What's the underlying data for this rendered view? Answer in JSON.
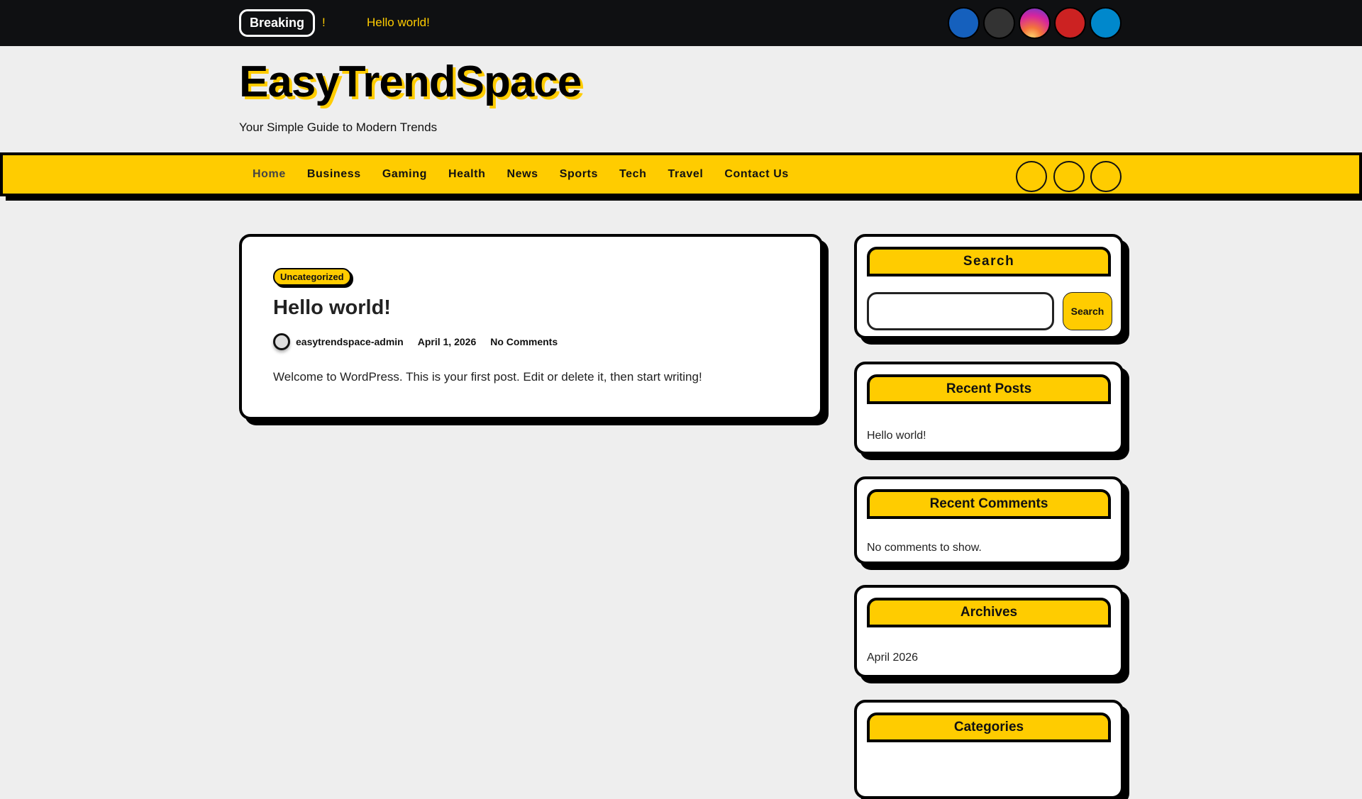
{
  "topbar": {
    "breaking_label": "Breaking",
    "ticker_separator": "!",
    "ticker_item": "Hello world!",
    "social": [
      {
        "icon": "facebook-icon",
        "color": "#1560bd"
      },
      {
        "icon": "x-twitter-icon",
        "color": "#333333"
      },
      {
        "icon": "instagram-icon",
        "color": "#d6249f"
      },
      {
        "icon": "youtube-icon",
        "color": "#cc2222"
      },
      {
        "icon": "telegram-icon",
        "color": "#0088cc"
      }
    ]
  },
  "header": {
    "site_title": "EasyTrendSpace",
    "tagline": "Your Simple Guide to Modern Trends"
  },
  "nav": {
    "items": [
      "Home",
      "Business",
      "Gaming",
      "Health",
      "News",
      "Sports",
      "Tech",
      "Travel",
      "Contact Us"
    ]
  },
  "post": {
    "category": "Uncategorized",
    "title": "Hello world!",
    "author": "easytrendspace-admin",
    "date": "April 1, 2026",
    "comments": "No Comments",
    "excerpt": "Welcome to WordPress. This is your first post. Edit or delete it, then start writing!"
  },
  "sidebar": {
    "search": {
      "title": "Search",
      "button": "Search",
      "placeholder": ""
    },
    "recent_posts": {
      "title": "Recent Posts",
      "items": [
        "Hello world!"
      ]
    },
    "recent_comments": {
      "title": "Recent Comments",
      "empty": "No comments to show."
    },
    "archives": {
      "title": "Archives",
      "items": [
        "April 2026"
      ]
    },
    "categories": {
      "title": "Categories"
    }
  },
  "colors": {
    "accent": "#ffcc00",
    "topbar": "#0f1012",
    "background": "#eeeeee"
  }
}
